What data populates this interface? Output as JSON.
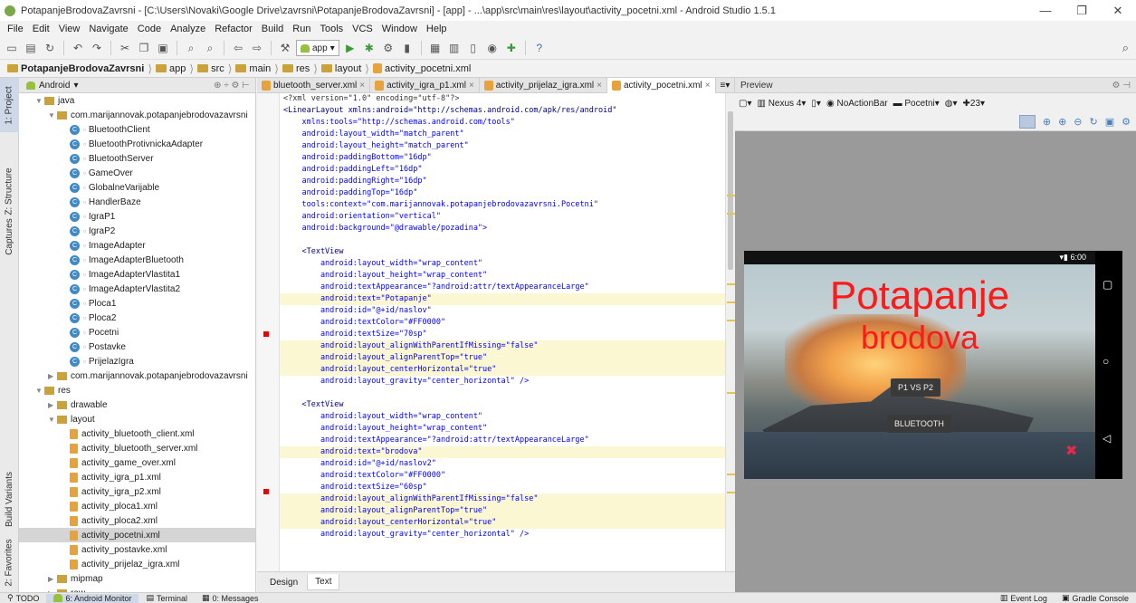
{
  "window": {
    "title": "PotapanjeBrodovaZavrsni - [C:\\Users\\Novaki\\Google Drive\\zavrsni\\PotapanjeBrodovaZavrsni] - [app] - ...\\app\\src\\main\\res\\layout\\activity_pocetni.xml - Android Studio 1.5.1",
    "min": "—",
    "max": "❐",
    "close": "✕"
  },
  "menu": [
    "File",
    "Edit",
    "View",
    "Navigate",
    "Code",
    "Analyze",
    "Refactor",
    "Build",
    "Run",
    "Tools",
    "VCS",
    "Window",
    "Help"
  ],
  "toolbar": {
    "app_config": "app"
  },
  "breadcrumb": [
    "PotapanjeBrodovaZavrsni",
    "app",
    "src",
    "main",
    "res",
    "layout",
    "activity_pocetni.xml"
  ],
  "side_tabs": {
    "project": "1: Project",
    "structure": "Z: Structure",
    "captures": "Captures",
    "build_variants": "Build Variants",
    "favorites": "2: Favorites"
  },
  "project_panel": {
    "view": "Android",
    "rows": [
      {
        "label": "java",
        "kind": "pkg",
        "indent": 1,
        "twisty": "▼"
      },
      {
        "label": "com.marijannovak.potapanjebrodovazavrsni",
        "kind": "pkg",
        "indent": 2,
        "twisty": "▼"
      },
      {
        "label": "BluetoothClient",
        "kind": "class",
        "indent": 3
      },
      {
        "label": "BluetoothProtivnickaAdapter",
        "kind": "class",
        "indent": 3
      },
      {
        "label": "BluetoothServer",
        "kind": "class",
        "indent": 3
      },
      {
        "label": "GameOver",
        "kind": "class",
        "indent": 3
      },
      {
        "label": "GlobalneVarijable",
        "kind": "class",
        "indent": 3
      },
      {
        "label": "HandlerBaze",
        "kind": "class",
        "indent": 3
      },
      {
        "label": "IgraP1",
        "kind": "class",
        "indent": 3
      },
      {
        "label": "IgraP2",
        "kind": "class",
        "indent": 3
      },
      {
        "label": "ImageAdapter",
        "kind": "class",
        "indent": 3
      },
      {
        "label": "ImageAdapterBluetooth",
        "kind": "class",
        "indent": 3
      },
      {
        "label": "ImageAdapterVlastita1",
        "kind": "class",
        "indent": 3
      },
      {
        "label": "ImageAdapterVlastita2",
        "kind": "class",
        "indent": 3
      },
      {
        "label": "Ploca1",
        "kind": "class",
        "indent": 3
      },
      {
        "label": "Ploca2",
        "kind": "class",
        "indent": 3
      },
      {
        "label": "Pocetni",
        "kind": "class",
        "indent": 3
      },
      {
        "label": "Postavke",
        "kind": "class",
        "indent": 3
      },
      {
        "label": "PrijelazIgra",
        "kind": "class",
        "indent": 3
      },
      {
        "label": "com.marijannovak.potapanjebrodovazavrsni",
        "kind": "pkg",
        "indent": 2,
        "twisty": "▶"
      },
      {
        "label": "res",
        "kind": "pkg",
        "indent": 1,
        "twisty": "▼"
      },
      {
        "label": "drawable",
        "kind": "pkg",
        "indent": 2,
        "twisty": "▶"
      },
      {
        "label": "layout",
        "kind": "pkg",
        "indent": 2,
        "twisty": "▼"
      },
      {
        "label": "activity_bluetooth_client.xml",
        "kind": "file",
        "indent": 3
      },
      {
        "label": "activity_bluetooth_server.xml",
        "kind": "file",
        "indent": 3
      },
      {
        "label": "activity_game_over.xml",
        "kind": "file",
        "indent": 3
      },
      {
        "label": "activity_igra_p1.xml",
        "kind": "file",
        "indent": 3
      },
      {
        "label": "activity_igra_p2.xml",
        "kind": "file",
        "indent": 3
      },
      {
        "label": "activity_ploca1.xml",
        "kind": "file",
        "indent": 3
      },
      {
        "label": "activity_ploca2.xml",
        "kind": "file",
        "indent": 3
      },
      {
        "label": "activity_pocetni.xml",
        "kind": "file",
        "indent": 3,
        "selected": true
      },
      {
        "label": "activity_postavke.xml",
        "kind": "file",
        "indent": 3
      },
      {
        "label": "activity_prijelaz_igra.xml",
        "kind": "file",
        "indent": 3
      },
      {
        "label": "mipmap",
        "kind": "pkg",
        "indent": 2,
        "twisty": "▶"
      },
      {
        "label": "raw",
        "kind": "pkg",
        "indent": 2,
        "twisty": "▶"
      }
    ]
  },
  "editor_tabs": [
    {
      "label": "bluetooth_server.xml",
      "active": false
    },
    {
      "label": "activity_igra_p1.xml",
      "active": false
    },
    {
      "label": "activity_prijelaz_igra.xml",
      "active": false
    },
    {
      "label": "activity_pocetni.xml",
      "active": true
    }
  ],
  "code_lines": [
    {
      "text": "<?xml version=\"1.0\" encoding=\"utf-8\"?>",
      "cls": "c-dark"
    },
    {
      "text": "<LinearLayout xmlns:android=\"http://schemas.android.com/apk/res/android\"",
      "cls": "c-tag"
    },
    {
      "text": "    xmlns:tools=\"http://schemas.android.com/tools\"",
      "cls": "c-attr"
    },
    {
      "text": "    android:layout_width=\"match_parent\"",
      "cls": "c-attr"
    },
    {
      "text": "    android:layout_height=\"match_parent\"",
      "cls": "c-attr"
    },
    {
      "text": "    android:paddingBottom=\"16dp\"",
      "cls": "c-attr"
    },
    {
      "text": "    android:paddingLeft=\"16dp\"",
      "cls": "c-attr"
    },
    {
      "text": "    android:paddingRight=\"16dp\"",
      "cls": "c-attr"
    },
    {
      "text": "    android:paddingTop=\"16dp\"",
      "cls": "c-attr"
    },
    {
      "text": "    tools:context=\"com.marijannovak.potapanjebrodovazavrsni.Pocetni\"",
      "cls": "c-attr"
    },
    {
      "text": "    android:orientation=\"vertical\"",
      "cls": "c-attr"
    },
    {
      "text": "    android:background=\"@drawable/pozadina\">",
      "cls": "c-attr"
    },
    {
      "text": "",
      "cls": "c-dark"
    },
    {
      "text": "    <TextView",
      "cls": "c-tag"
    },
    {
      "text": "        android:layout_width=\"wrap_content\"",
      "cls": "c-attr"
    },
    {
      "text": "        android:layout_height=\"wrap_content\"",
      "cls": "c-attr"
    },
    {
      "text": "        android:textAppearance=\"?android:attr/textAppearanceLarge\"",
      "cls": "c-attr"
    },
    {
      "text": "        android:text=\"Potapanje\"",
      "cls": "c-attr",
      "hl": true
    },
    {
      "text": "        android:id=\"@+id/naslov\"",
      "cls": "c-attr"
    },
    {
      "text": "        android:textColor=\"#FF0000\"",
      "cls": "c-attr"
    },
    {
      "text": "        android:textSize=\"70sp\"",
      "cls": "c-attr"
    },
    {
      "text": "        android:layout_alignWithParentIfMissing=\"false\"",
      "cls": "c-attr",
      "hl": true
    },
    {
      "text": "        android:layout_alignParentTop=\"true\"",
      "cls": "c-attr",
      "hl": true
    },
    {
      "text": "        android:layout_centerHorizontal=\"true\"",
      "cls": "c-attr",
      "hl": true
    },
    {
      "text": "        android:layout_gravity=\"center_horizontal\" />",
      "cls": "c-attr"
    },
    {
      "text": "",
      "cls": "c-dark"
    },
    {
      "text": "    <TextView",
      "cls": "c-tag"
    },
    {
      "text": "        android:layout_width=\"wrap_content\"",
      "cls": "c-attr"
    },
    {
      "text": "        android:layout_height=\"wrap_content\"",
      "cls": "c-attr"
    },
    {
      "text": "        android:textAppearance=\"?android:attr/textAppearanceLarge\"",
      "cls": "c-attr"
    },
    {
      "text": "        android:text=\"brodova\"",
      "cls": "c-attr",
      "hl": true
    },
    {
      "text": "        android:id=\"@+id/naslov2\"",
      "cls": "c-attr"
    },
    {
      "text": "        android:textColor=\"#FF0000\"",
      "cls": "c-attr"
    },
    {
      "text": "        android:textSize=\"60sp\"",
      "cls": "c-attr"
    },
    {
      "text": "        android:layout_alignWithParentIfMissing=\"false\"",
      "cls": "c-attr",
      "hl": true
    },
    {
      "text": "        android:layout_alignParentTop=\"true\"",
      "cls": "c-attr",
      "hl": true
    },
    {
      "text": "        android:layout_centerHorizontal=\"true\"",
      "cls": "c-attr",
      "hl": true
    },
    {
      "text": "        android:layout_gravity=\"center_horizontal\" />",
      "cls": "c-attr"
    }
  ],
  "editor_bottom_tabs": [
    "Design",
    "Text"
  ],
  "preview": {
    "title": "Preview",
    "device": "Nexus 4",
    "theme": "NoActionBar",
    "activity": "Pocetni",
    "api": "23",
    "time": "6:00",
    "title1": "Potapanje",
    "title2": "brodova",
    "btn_p1": "P1 VS P2",
    "btn_bt": "BLUETOOTH"
  },
  "bottombar": {
    "todo": "TODO",
    "monitor": "6: Android Monitor",
    "terminal": "Terminal",
    "messages": "0: Messages",
    "event_log": "Event Log",
    "gradle_console": "Gradle Console"
  }
}
